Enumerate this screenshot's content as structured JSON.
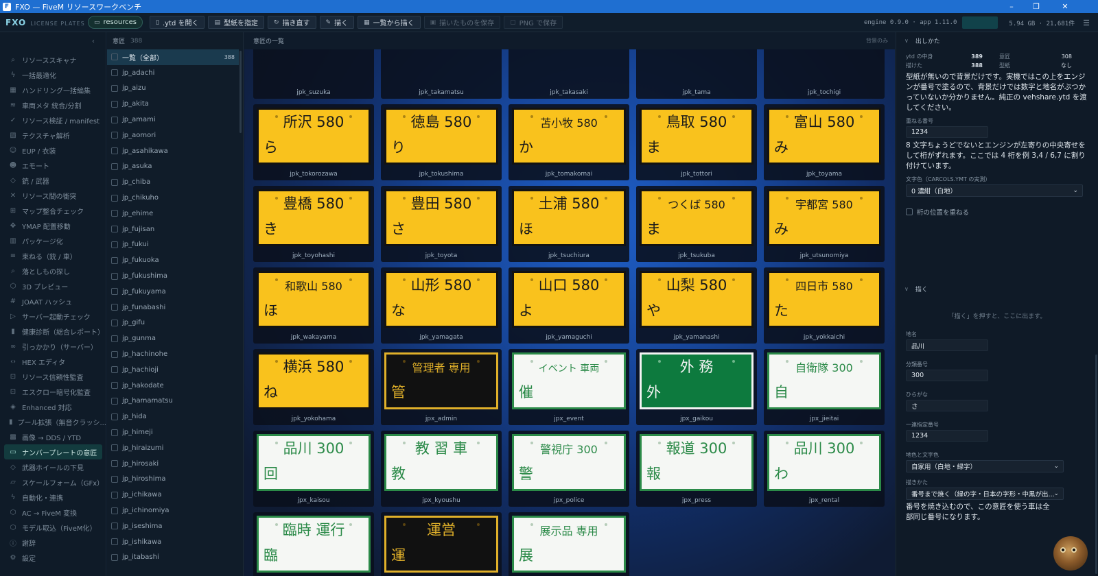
{
  "window": {
    "title": "FXO — FiveM リソースワークベンチ",
    "controls": [
      "–",
      "❐",
      "✕"
    ]
  },
  "brand": {
    "name": "FXO",
    "sub": "LICENSE PLATES"
  },
  "toolbar": [
    {
      "icon": "folder-icon",
      "label": "resources",
      "pill": true
    },
    {
      "icon": "file-icon",
      "label": ".ytd を開く"
    },
    {
      "icon": "paper-icon",
      "label": "型紙を指定"
    },
    {
      "icon": "refresh-icon",
      "label": "描き直す"
    },
    {
      "icon": "draw-icon",
      "label": "描く"
    },
    {
      "icon": "grid-icon",
      "label": "一覧から描く"
    },
    {
      "icon": "save-icon",
      "label": "描いたものを保存",
      "disabled": true
    },
    {
      "icon": "png-icon",
      "label": "PNG で保存",
      "disabled": true
    }
  ],
  "status": {
    "engine": "engine 0.9.0 · app 1.11.0",
    "disk": "5.94 GB · 21,681件"
  },
  "sidebar": {
    "collapse": "‹",
    "items": [
      {
        "icon": "search-icon",
        "label": "リソーススキャナ"
      },
      {
        "icon": "bolt-icon",
        "label": "一括最適化"
      },
      {
        "icon": "grid-icon",
        "label": "ハンドリング一括編集"
      },
      {
        "icon": "layers-icon",
        "label": "車両メタ 統合/分割"
      },
      {
        "icon": "check-icon",
        "label": "リソース検証 / manifest"
      },
      {
        "icon": "texture-icon",
        "label": "テクスチャ解析"
      },
      {
        "icon": "person-icon",
        "label": "EUP / 衣装"
      },
      {
        "icon": "smile-icon",
        "label": "エモート"
      },
      {
        "icon": "diamond-icon",
        "label": "銃 / 武器"
      },
      {
        "icon": "x-icon",
        "label": "リソース間の衝突"
      },
      {
        "icon": "map-icon",
        "label": "マップ整合チェック"
      },
      {
        "icon": "move-icon",
        "label": "YMAP 配置移動"
      },
      {
        "icon": "package-icon",
        "label": "パッケージ化"
      },
      {
        "icon": "stack-icon",
        "label": "束ねる（銃 / 車）"
      },
      {
        "icon": "search-icon",
        "label": "落としもの探し"
      },
      {
        "icon": "cube-icon",
        "label": "3D プレビュー"
      },
      {
        "icon": "hash-icon",
        "label": "JOAAT ハッシュ"
      },
      {
        "icon": "play-icon",
        "label": "サーバー起動チェック"
      },
      {
        "icon": "chart-icon",
        "label": "健康診断（総合レポート）"
      },
      {
        "icon": "link-icon",
        "label": "引っかかり（サーバー）"
      },
      {
        "icon": "code-icon",
        "label": "HEX エディタ"
      },
      {
        "icon": "lock-icon",
        "label": "リソース信頼性監査"
      },
      {
        "icon": "lock-icon",
        "label": "エスクロー暗号化監査"
      },
      {
        "icon": "shield-icon",
        "label": "Enhanced 対応"
      },
      {
        "icon": "chart-icon",
        "label": "プール拡張（無音クラッシ..."
      },
      {
        "icon": "image-icon",
        "label": "画像 → DDS / YTD"
      },
      {
        "icon": "plate-icon",
        "label": "ナンバープレートの意匠",
        "active": true
      },
      {
        "icon": "diamond-icon",
        "label": "武器ホイールの下見"
      },
      {
        "icon": "scale-icon",
        "label": "スケールフォーム（GFx）"
      },
      {
        "icon": "bolt-icon",
        "label": "自動化・連携"
      },
      {
        "icon": "cube-icon",
        "label": "AC → FiveM 変換"
      },
      {
        "icon": "cube-icon",
        "label": "モデル取込（FiveM化）"
      },
      {
        "icon": "info-icon",
        "label": "謝辞"
      },
      {
        "icon": "gear-icon",
        "label": "設定"
      }
    ]
  },
  "list": {
    "title": "意匠",
    "count": "388",
    "items": [
      {
        "label": "一覧（全部）",
        "count": "388",
        "active": true
      },
      {
        "label": "jp_adachi"
      },
      {
        "label": "jp_aizu"
      },
      {
        "label": "jp_akita"
      },
      {
        "label": "jp_amami"
      },
      {
        "label": "jp_aomori"
      },
      {
        "label": "jp_asahikawa"
      },
      {
        "label": "jp_asuka"
      },
      {
        "label": "jp_chiba"
      },
      {
        "label": "jp_chikuho"
      },
      {
        "label": "jp_ehime"
      },
      {
        "label": "jp_fujisan"
      },
      {
        "label": "jp_fukui"
      },
      {
        "label": "jp_fukuoka"
      },
      {
        "label": "jp_fukushima"
      },
      {
        "label": "jp_fukuyama"
      },
      {
        "label": "jp_funabashi"
      },
      {
        "label": "jp_gifu"
      },
      {
        "label": "jp_gunma"
      },
      {
        "label": "jp_hachinohe"
      },
      {
        "label": "jp_hachioji"
      },
      {
        "label": "jp_hakodate"
      },
      {
        "label": "jp_hamamatsu"
      },
      {
        "label": "jp_hida"
      },
      {
        "label": "jp_himeji"
      },
      {
        "label": "jp_hiraizumi"
      },
      {
        "label": "jp_hirosaki"
      },
      {
        "label": "jp_hiroshima"
      },
      {
        "label": "jp_ichikawa"
      },
      {
        "label": "jp_ichinomiya"
      },
      {
        "label": "jp_iseshima"
      },
      {
        "label": "jp_ishikawa"
      },
      {
        "label": "jp_itabashi"
      }
    ]
  },
  "gallery": {
    "title": "意匠の一覧",
    "right": "背景のみ",
    "partial": [
      {
        "id": "jpk_suzuka"
      },
      {
        "id": "jpk_takamatsu"
      },
      {
        "id": "jpk_takasaki"
      },
      {
        "id": "jpk_tama"
      },
      {
        "id": "jpk_tochigi"
      }
    ],
    "plates": [
      {
        "id": "jpk_tokorozawa",
        "top": "所沢 580",
        "kana": "ら",
        "style": "y"
      },
      {
        "id": "jpk_tokushima",
        "top": "徳島 580",
        "kana": "り",
        "style": "y"
      },
      {
        "id": "jpk_tomakomai",
        "top": "苫小牧 580",
        "kana": "か",
        "style": "y",
        "size": "sm"
      },
      {
        "id": "jpk_tottori",
        "top": "鳥取 580",
        "kana": "ま",
        "style": "y"
      },
      {
        "id": "jpk_toyama",
        "top": "富山 580",
        "kana": "み",
        "style": "y"
      },
      {
        "id": "jpk_toyohashi",
        "top": "豊橋 580",
        "kana": "き",
        "style": "y"
      },
      {
        "id": "jpk_toyota",
        "top": "豊田 580",
        "kana": "さ",
        "style": "y"
      },
      {
        "id": "jpk_tsuchiura",
        "top": "土浦 580",
        "kana": "ほ",
        "style": "y"
      },
      {
        "id": "jpk_tsukuba",
        "top": "つくば 580",
        "kana": "ま",
        "style": "y",
        "size": "sm"
      },
      {
        "id": "jpk_utsunomiya",
        "top": "宇都宮 580",
        "kana": "み",
        "style": "y",
        "size": "sm"
      },
      {
        "id": "jpk_wakayama",
        "top": "和歌山 580",
        "kana": "ほ",
        "style": "y",
        "size": "sm"
      },
      {
        "id": "jpk_yamagata",
        "top": "山形 580",
        "kana": "な",
        "style": "y"
      },
      {
        "id": "jpk_yamaguchi",
        "top": "山口 580",
        "kana": "よ",
        "style": "y"
      },
      {
        "id": "jpk_yamanashi",
        "top": "山梨 580",
        "kana": "や",
        "style": "y"
      },
      {
        "id": "jpk_yokkaichi",
        "top": "四日市 580",
        "kana": "た",
        "style": "y",
        "size": "sm"
      },
      {
        "id": "jpk_yokohama",
        "top": "横浜 580",
        "kana": "ね",
        "style": "y"
      },
      {
        "id": "jpx_admin",
        "top": "管理者 専用",
        "kana": "管",
        "style": "k",
        "size": "sm"
      },
      {
        "id": "jpx_event",
        "top": "イベント 車両",
        "kana": "催",
        "style": "w",
        "size": "xs"
      },
      {
        "id": "jpx_gaikou",
        "top": "外 務",
        "kana": "外",
        "style": "g"
      },
      {
        "id": "jpx_jieitai",
        "top": "自衛隊 300",
        "kana": "自",
        "style": "w",
        "size": "sm"
      },
      {
        "id": "jpx_kaisou",
        "top": "品川 300",
        "kana": "回",
        "style": "w"
      },
      {
        "id": "jpx_kyoushu",
        "top": "教 習 車",
        "kana": "教",
        "style": "w"
      },
      {
        "id": "jpx_police",
        "top": "警視庁 300",
        "kana": "警",
        "style": "w",
        "size": "sm"
      },
      {
        "id": "jpx_press",
        "top": "報道 300",
        "kana": "報",
        "style": "w"
      },
      {
        "id": "jpx_rental",
        "top": "品川 300",
        "kana": "わ",
        "style": "w"
      },
      {
        "id": "jpx_rinji",
        "top": "臨時 運行",
        "kana": "臨",
        "style": "w"
      },
      {
        "id": "jpx_staff",
        "top": "運営",
        "kana": "運",
        "style": "k"
      },
      {
        "id": "jpx_tenji",
        "top": "展示品 専用",
        "kana": "展",
        "style": "w",
        "size": "sm"
      }
    ]
  },
  "right": {
    "section1": "出しかた",
    "stats": [
      {
        "k": "ytd の中身",
        "v": "389",
        "k2": "意匠",
        "v2": "308"
      },
      {
        "k": "描けた",
        "v": "388",
        "k2": "型紙",
        "v2": "なし"
      }
    ],
    "desc": "型紙が無いので背景だけです。実機ではこの上をエンジンが番号で塗るので、背景だけでは数字と地名がぶつかっていないか分かりません。純正の vehshare.ytd を渡してください。",
    "overlay_label": "重ねる番号",
    "overlay_value": "1234",
    "overlay_note": "8 文字ちょうどでないとエンジンが左寄りの中央寄せをして桁がずれます。ここでは 4 桁を例 3,4 / 6,7 に割り付けています。",
    "color_label": "文字色（CARCOLS.YMT の実測）",
    "color_value": "0 濃紺（白地）",
    "check_label": "桁の位置を重ねる",
    "section2": "描く",
    "note": "「描く」を押すと、ここに出ます。",
    "fields": [
      {
        "label": "地名",
        "value": "品川"
      },
      {
        "label": "分類番号",
        "value": "300"
      },
      {
        "label": "ひらがな",
        "value": "さ"
      },
      {
        "label": "一連指定番号",
        "value": "1234"
      }
    ],
    "style_label": "地色と文字色",
    "style_value": "自家用（白地・緑字）",
    "method_label": "描きかた",
    "method_value": "番号まで焼く（緑の字・日本の字形・中黒が出...",
    "method_note": "番号を焼き込むので、この意匠を使う車は全部同じ番号になります。"
  }
}
